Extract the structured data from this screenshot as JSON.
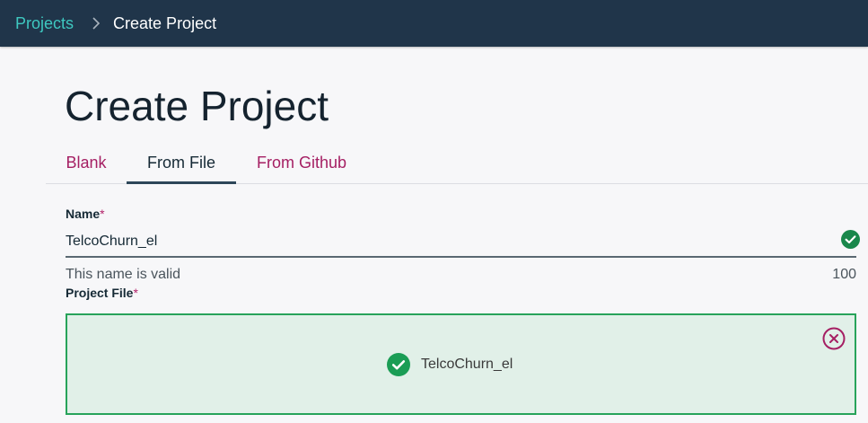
{
  "breadcrumb": {
    "root_label": "Projects",
    "current_label": "Create Project"
  },
  "page": {
    "title": "Create Project"
  },
  "tabs": [
    {
      "label": "Blank",
      "active": false
    },
    {
      "label": "From File",
      "active": true
    },
    {
      "label": "From Github",
      "active": false
    }
  ],
  "form": {
    "name": {
      "label": "Name",
      "required_mark": "*",
      "value": "TelcoChurn_el",
      "status_icon": "check-circle-icon",
      "helper_text": "This name is valid",
      "char_remaining": "100"
    },
    "project_file": {
      "label": "Project File",
      "required_mark": "*",
      "file_name": "TelcoChurn_el",
      "status_icon": "check-circle-icon",
      "remove_icon": "close-circle-icon"
    }
  },
  "colors": {
    "header_bg": "#20354a",
    "breadcrumb_link": "#3ec8c0",
    "tab_inactive": "#a51f63",
    "success_green": "#27a35a",
    "dropzone_bg": "#e1f0e8"
  }
}
